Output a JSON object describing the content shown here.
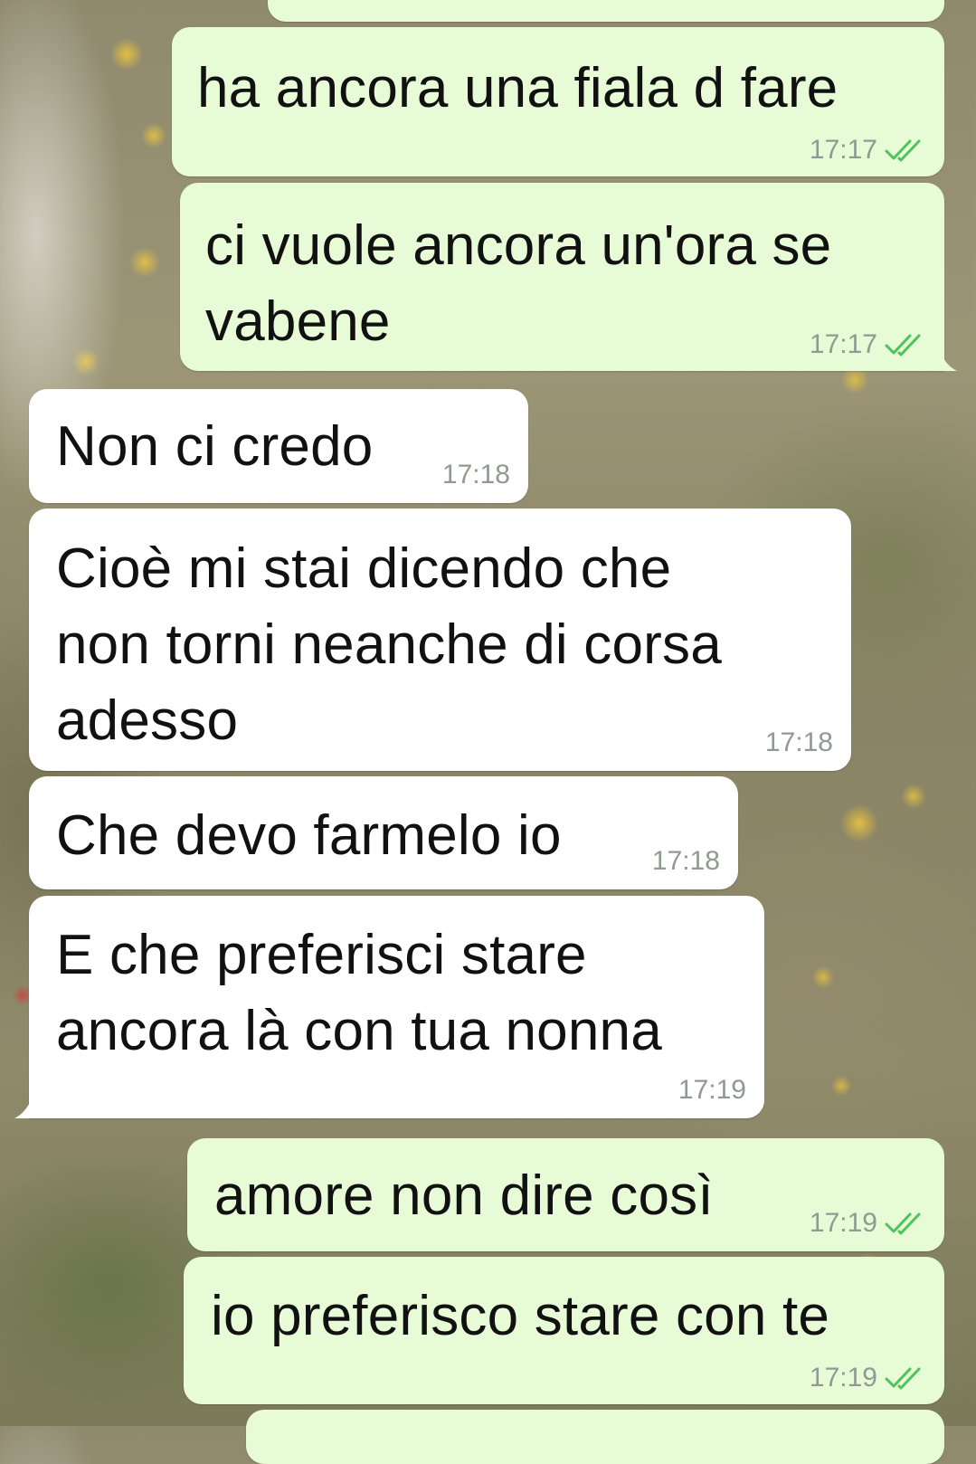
{
  "messages": [
    {
      "direction": "outgoing",
      "lines": [
        "ha ancora una fiala d fare"
      ],
      "time": "17:17",
      "status": "read"
    },
    {
      "direction": "outgoing",
      "lines": [
        "ci vuole ancora un'ora se",
        "vabene"
      ],
      "time": "17:17",
      "status": "read"
    },
    {
      "direction": "incoming",
      "lines": [
        "Non ci credo"
      ],
      "time": "17:18"
    },
    {
      "direction": "incoming",
      "lines": [
        "Cioè mi stai dicendo che",
        "non torni neanche di corsa",
        "adesso"
      ],
      "time": "17:18"
    },
    {
      "direction": "incoming",
      "lines": [
        "Che devo farmelo io"
      ],
      "time": "17:18"
    },
    {
      "direction": "incoming",
      "lines": [
        "E che preferisci stare",
        "ancora là con tua nonna"
      ],
      "time": "17:19"
    },
    {
      "direction": "outgoing",
      "lines": [
        "amore non dire così"
      ],
      "time": "17:19",
      "status": "read"
    },
    {
      "direction": "outgoing",
      "lines": [
        "io preferisco stare con te"
      ],
      "time": "17:19",
      "status": "read"
    }
  ],
  "colors": {
    "outgoing_bubble": "#e7fbd7",
    "incoming_bubble": "#ffffff",
    "read_ticks": "#4fc35b",
    "timestamp": "#8f9a93"
  },
  "icons": {
    "read_receipt": "double-check-icon"
  }
}
